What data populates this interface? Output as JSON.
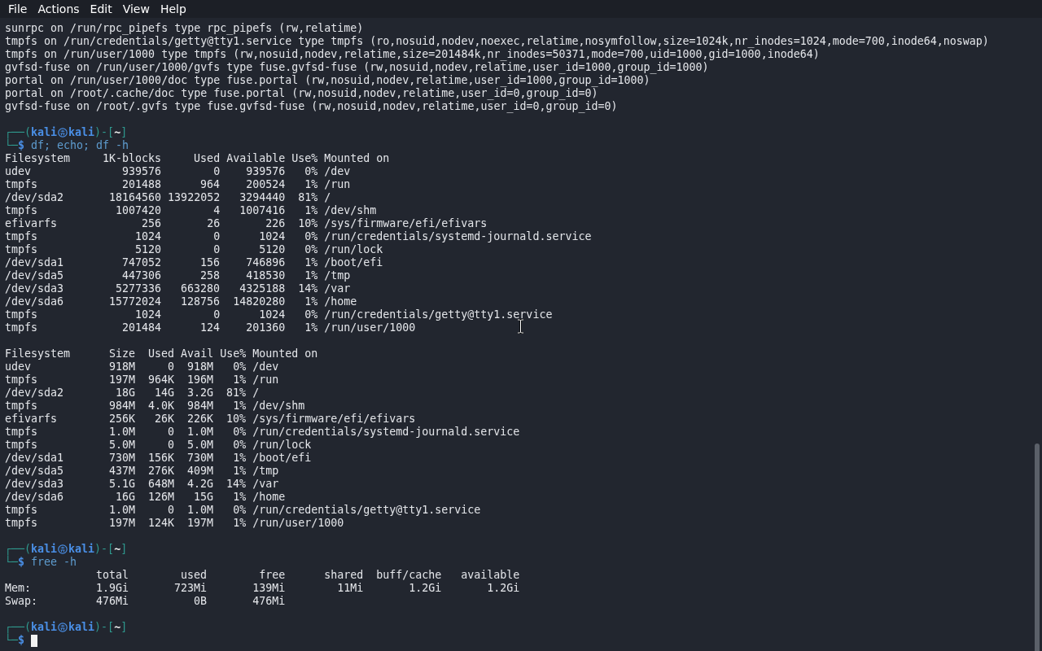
{
  "menu": [
    "File",
    "Actions",
    "Edit",
    "View",
    "Help"
  ],
  "terminal": [
    {
      "kind": "lines",
      "lines": [
        "sunrpc on /run/rpc_pipefs type rpc_pipefs (rw,relatime)",
        "tmpfs on /run/credentials/getty@tty1.service type tmpfs (ro,nosuid,nodev,noexec,relatime,nosymfollow,size=1024k,nr_inodes=1024,mode=700,inode64,noswap)",
        "tmpfs on /run/user/1000 type tmpfs (rw,nosuid,nodev,relatime,size=201484k,nr_inodes=50371,mode=700,uid=1000,gid=1000,inode64)",
        "gvfsd-fuse on /run/user/1000/gvfs type fuse.gvfsd-fuse (rw,nosuid,nodev,relatime,user_id=1000,group_id=1000)",
        "portal on /run/user/1000/doc type fuse.portal (rw,nosuid,nodev,relatime,user_id=1000,group_id=1000)",
        "portal on /root/.cache/doc type fuse.portal (rw,nosuid,nodev,relatime,user_id=0,group_id=0)",
        "gvfsd-fuse on /root/.gvfs type fuse.gvfsd-fuse (rw,nosuid,nodev,relatime,user_id=0,group_id=0)"
      ]
    },
    {
      "kind": "blank"
    },
    {
      "kind": "prompt",
      "open": "┌──(",
      "user": "kali",
      "host": "kali",
      "mid": ")-[",
      "dir": "~",
      "close": "]",
      "corner": "└─",
      "sigil": "$",
      "command": "df; echo; df -h",
      "cursor": false
    },
    {
      "kind": "df",
      "columns": [
        "Filesystem",
        "1K-blocks",
        "Used",
        "Available",
        "Use%",
        "Mounted on"
      ],
      "rows": [
        [
          "udev",
          "939576",
          "0",
          "939576",
          "0%",
          "/dev"
        ],
        [
          "tmpfs",
          "201488",
          "964",
          "200524",
          "1%",
          "/run"
        ],
        [
          "/dev/sda2",
          "18164560",
          "13922052",
          "3294440",
          "81%",
          "/"
        ],
        [
          "tmpfs",
          "1007420",
          "4",
          "1007416",
          "1%",
          "/dev/shm"
        ],
        [
          "efivarfs",
          "256",
          "26",
          "226",
          "10%",
          "/sys/firmware/efi/efivars"
        ],
        [
          "tmpfs",
          "1024",
          "0",
          "1024",
          "0%",
          "/run/credentials/systemd-journald.service"
        ],
        [
          "tmpfs",
          "5120",
          "0",
          "5120",
          "0%",
          "/run/lock"
        ],
        [
          "/dev/sda1",
          "747052",
          "156",
          "746896",
          "1%",
          "/boot/efi"
        ],
        [
          "/dev/sda5",
          "447306",
          "258",
          "418530",
          "1%",
          "/tmp"
        ],
        [
          "/dev/sda3",
          "5277336",
          "663280",
          "4325188",
          "14%",
          "/var"
        ],
        [
          "/dev/sda6",
          "15772024",
          "128756",
          "14820280",
          "1%",
          "/home"
        ],
        [
          "tmpfs",
          "1024",
          "0",
          "1024",
          "0%",
          "/run/credentials/getty@tty1.service"
        ],
        [
          "tmpfs",
          "201484",
          "124",
          "201360",
          "1%",
          "/run/user/1000"
        ]
      ]
    },
    {
      "kind": "blank"
    },
    {
      "kind": "df_h",
      "columns": [
        "Filesystem",
        "Size",
        "Used",
        "Avail",
        "Use%",
        "Mounted on"
      ],
      "rows": [
        [
          "udev",
          "918M",
          "0",
          "918M",
          "0%",
          "/dev"
        ],
        [
          "tmpfs",
          "197M",
          "964K",
          "196M",
          "1%",
          "/run"
        ],
        [
          "/dev/sda2",
          "18G",
          "14G",
          "3.2G",
          "81%",
          "/"
        ],
        [
          "tmpfs",
          "984M",
          "4.0K",
          "984M",
          "1%",
          "/dev/shm"
        ],
        [
          "efivarfs",
          "256K",
          "26K",
          "226K",
          "10%",
          "/sys/firmware/efi/efivars"
        ],
        [
          "tmpfs",
          "1.0M",
          "0",
          "1.0M",
          "0%",
          "/run/credentials/systemd-journald.service"
        ],
        [
          "tmpfs",
          "5.0M",
          "0",
          "5.0M",
          "0%",
          "/run/lock"
        ],
        [
          "/dev/sda1",
          "730M",
          "156K",
          "730M",
          "1%",
          "/boot/efi"
        ],
        [
          "/dev/sda5",
          "437M",
          "276K",
          "409M",
          "1%",
          "/tmp"
        ],
        [
          "/dev/sda3",
          "5.1G",
          "648M",
          "4.2G",
          "14%",
          "/var"
        ],
        [
          "/dev/sda6",
          "16G",
          "126M",
          "15G",
          "1%",
          "/home"
        ],
        [
          "tmpfs",
          "1.0M",
          "0",
          "1.0M",
          "0%",
          "/run/credentials/getty@tty1.service"
        ],
        [
          "tmpfs",
          "197M",
          "124K",
          "197M",
          "1%",
          "/run/user/1000"
        ]
      ]
    },
    {
      "kind": "blank"
    },
    {
      "kind": "prompt",
      "open": "┌──(",
      "user": "kali",
      "host": "kali",
      "mid": ")-[",
      "dir": "~",
      "close": "]",
      "corner": "└─",
      "sigil": "$",
      "command": "free -h",
      "cursor": false
    },
    {
      "kind": "free",
      "columns": [
        "total",
        "used",
        "free",
        "shared",
        "buff/cache",
        "available"
      ],
      "rows": [
        {
          "label": "Mem:",
          "values": [
            "1.9Gi",
            "723Mi",
            "139Mi",
            "11Mi",
            "1.2Gi",
            "1.2Gi"
          ]
        },
        {
          "label": "Swap:",
          "values": [
            "476Mi",
            "0B",
            "476Mi"
          ]
        }
      ]
    },
    {
      "kind": "blank"
    },
    {
      "kind": "prompt",
      "open": "┌──(",
      "user": "kali",
      "host": "kali",
      "mid": ")-[",
      "dir": "~",
      "close": "]",
      "corner": "└─",
      "sigil": "$",
      "cursor": true
    }
  ],
  "mouse_pointer": {
    "kind": "ibeam"
  }
}
